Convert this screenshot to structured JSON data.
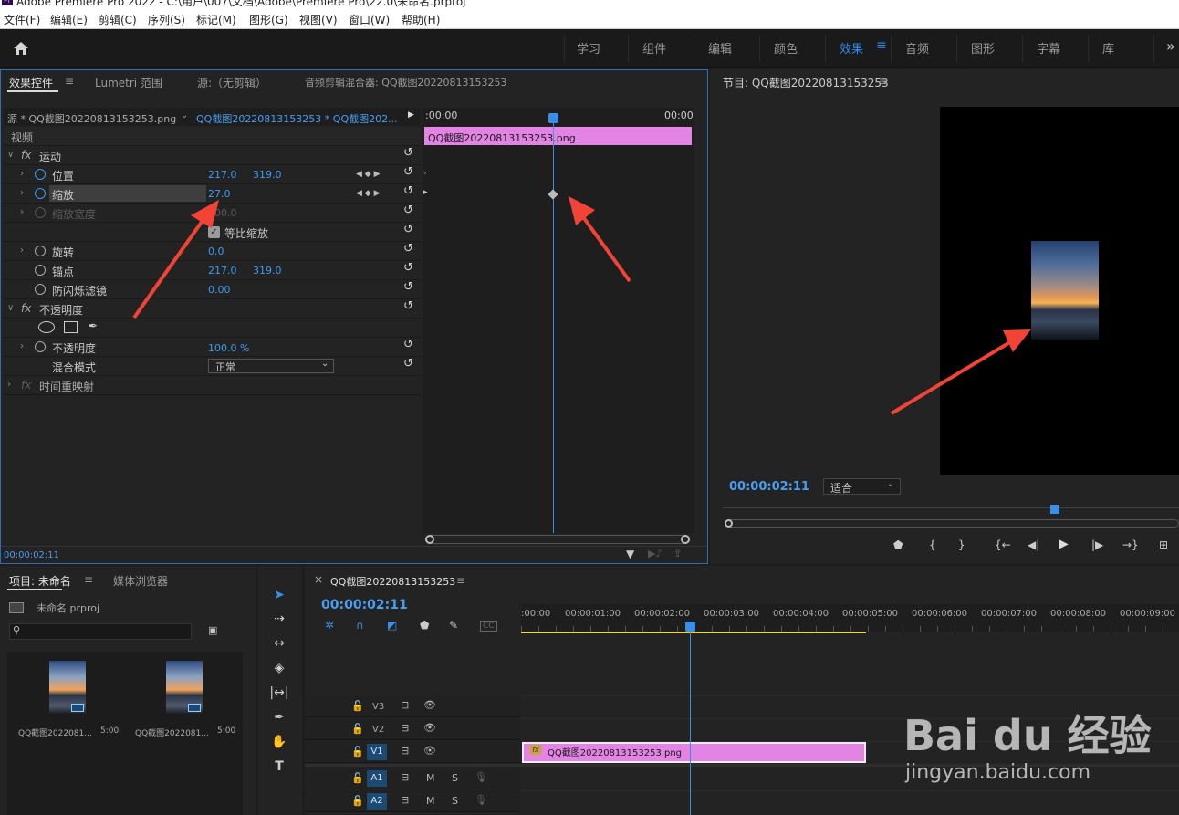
{
  "window": {
    "title": "Adobe Premiere Pro 2022 - C:\\用户\\007\\文档\\Adobe\\Premiere Pro\\22.0\\未命名.prproj",
    "app_icon": "Pr"
  },
  "menu": [
    "文件(F)",
    "编辑(E)",
    "剪辑(C)",
    "序列(S)",
    "标记(M)",
    "图形(G)",
    "视图(V)",
    "窗口(W)",
    "帮助(H)"
  ],
  "workspaces": {
    "items": [
      "学习",
      "组件",
      "编辑",
      "颜色",
      "效果",
      "音频",
      "图形",
      "字幕",
      "库"
    ],
    "active": "效果",
    "more": "»"
  },
  "effect_panel": {
    "tabs": {
      "effect_controls": "效果控件",
      "lumetri": "Lumetri 范围",
      "source": "源:（无剪辑）",
      "audio_mixer": "音频剪辑混合器: QQ截图20220813153253"
    },
    "source_label": "源 * QQ截图20220813153253.png",
    "sequence_label": "QQ截图20220813153253 * QQ截图202...",
    "time_start": ":00:00",
    "time_end": "00:00",
    "clip_name": "QQ截图20220813153253.png",
    "video_header": "视频",
    "motion": {
      "label": "运动",
      "position_label": "位置",
      "position_x": "217.0",
      "position_y": "319.0",
      "scale_label": "缩放",
      "scale_value": "27.0",
      "scale_width_label": "缩放宽度",
      "scale_width_value": "100.0",
      "uniform_label": "等比缩放",
      "rotation_label": "旋转",
      "rotation_value": "0.0",
      "anchor_label": "锚点",
      "anchor_x": "217.0",
      "anchor_y": "319.0",
      "antiflicker_label": "防闪烁滤镜",
      "antiflicker_value": "0.00"
    },
    "opacity": {
      "label": "不透明度",
      "value_label": "不透明度",
      "value": "100.0 %",
      "blend_label": "混合模式",
      "blend_value": "正常"
    },
    "time_remap": "时间重映射",
    "timecode": "00:00:02:11"
  },
  "program": {
    "title": "节目: QQ截图20220813153253",
    "timecode": "00:00:02:11",
    "fit": "适合"
  },
  "project": {
    "tabs": {
      "project": "项目: 未命名",
      "media_browser": "媒体浏览器"
    },
    "file": "未命名.prproj",
    "items": [
      {
        "name": "QQ截图2022081...",
        "duration": "5:00"
      },
      {
        "name": "QQ截图2022081...",
        "duration": "5:00"
      }
    ]
  },
  "timeline": {
    "tab": "QQ截图20220813153253",
    "close": "×",
    "timecode": "00:00:02:11",
    "ruler": [
      ":00:00",
      "00:00:01:00",
      "00:00:02:00",
      "00:00:03:00",
      "00:00:04:00",
      "00:00:05:00",
      "00:00:06:00",
      "00:00:07:00",
      "00:00:08:00",
      "00:00:09:00"
    ],
    "tracks": [
      {
        "name": "V3",
        "toggle": ""
      },
      {
        "name": "V2",
        "toggle": ""
      },
      {
        "name": "V1",
        "toggle": "V1"
      },
      {
        "name": "A1",
        "toggle": "A1"
      },
      {
        "name": "A2",
        "toggle": "A2"
      }
    ],
    "clip": "QQ截图20220813153253.png",
    "mute": "M",
    "solo": "S"
  },
  "colors": {
    "accent": "#2d8ceb",
    "clip": "#e383e3",
    "playhead": "#3a8eea",
    "arrow": "#f24436"
  },
  "watermark": {
    "brand": "Bai du 经验",
    "url": "jingyan.baidu.com"
  }
}
